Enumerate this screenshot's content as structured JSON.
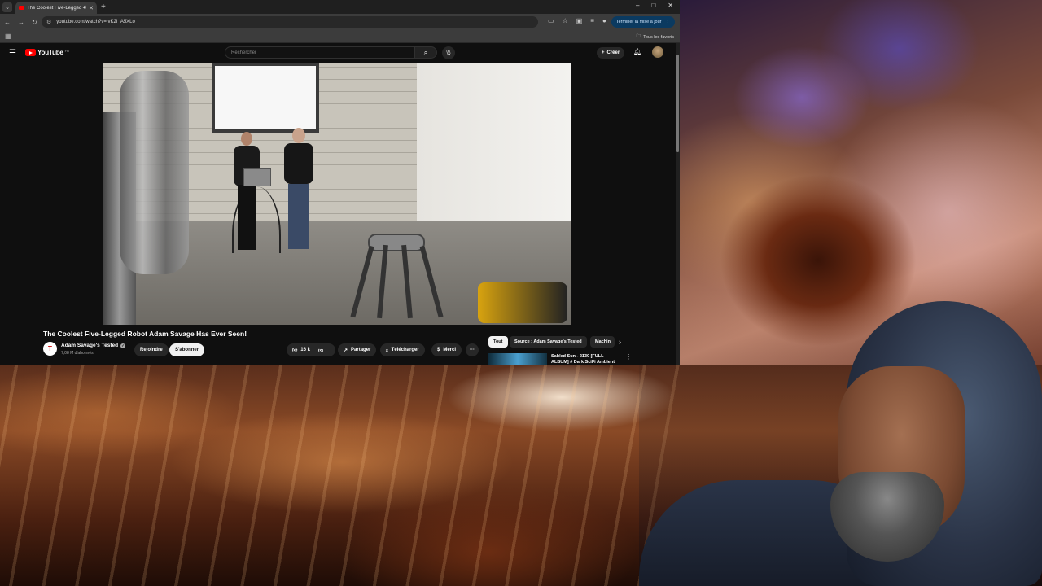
{
  "browser": {
    "tab_title": "The Coolest Five-Legged Ro",
    "url": "youtube.com/watch?v=IvK2I_A5XLo",
    "update_button": "Terminer la mise à jour",
    "all_favorites": "Tous les favoris",
    "window_controls": [
      "–",
      "□",
      "✕"
    ]
  },
  "youtube": {
    "logo_text": "YouTube",
    "logo_country": "FR",
    "search_placeholder": "Rechercher",
    "create_label": "Créer",
    "video": {
      "title": "The Coolest Five-Legged Robot Adam Savage Has Ever Seen!",
      "channel_initial": "T",
      "channel_name": "Adam Savage's Tested",
      "subscribers": "7,08 M d'abonnés",
      "join_label": "Rejoindre",
      "subscribe_label": "S'abonner",
      "likes": "16 k",
      "share_label": "Partager",
      "download_label": "Télécharger",
      "thanks_label": "Merci",
      "more_label": "···"
    },
    "chips": [
      "Tout",
      "Source : Adam Savage's Tested",
      "Machin"
    ],
    "recommendation": {
      "title": "Sabled Sun - 2130 [FULL ALBUM] # Dark SciFi Ambient"
    }
  },
  "colors": {
    "yt_bg": "#0f0f0f",
    "yt_red": "#ff0000",
    "update_button_bg": "#0b3a60"
  }
}
